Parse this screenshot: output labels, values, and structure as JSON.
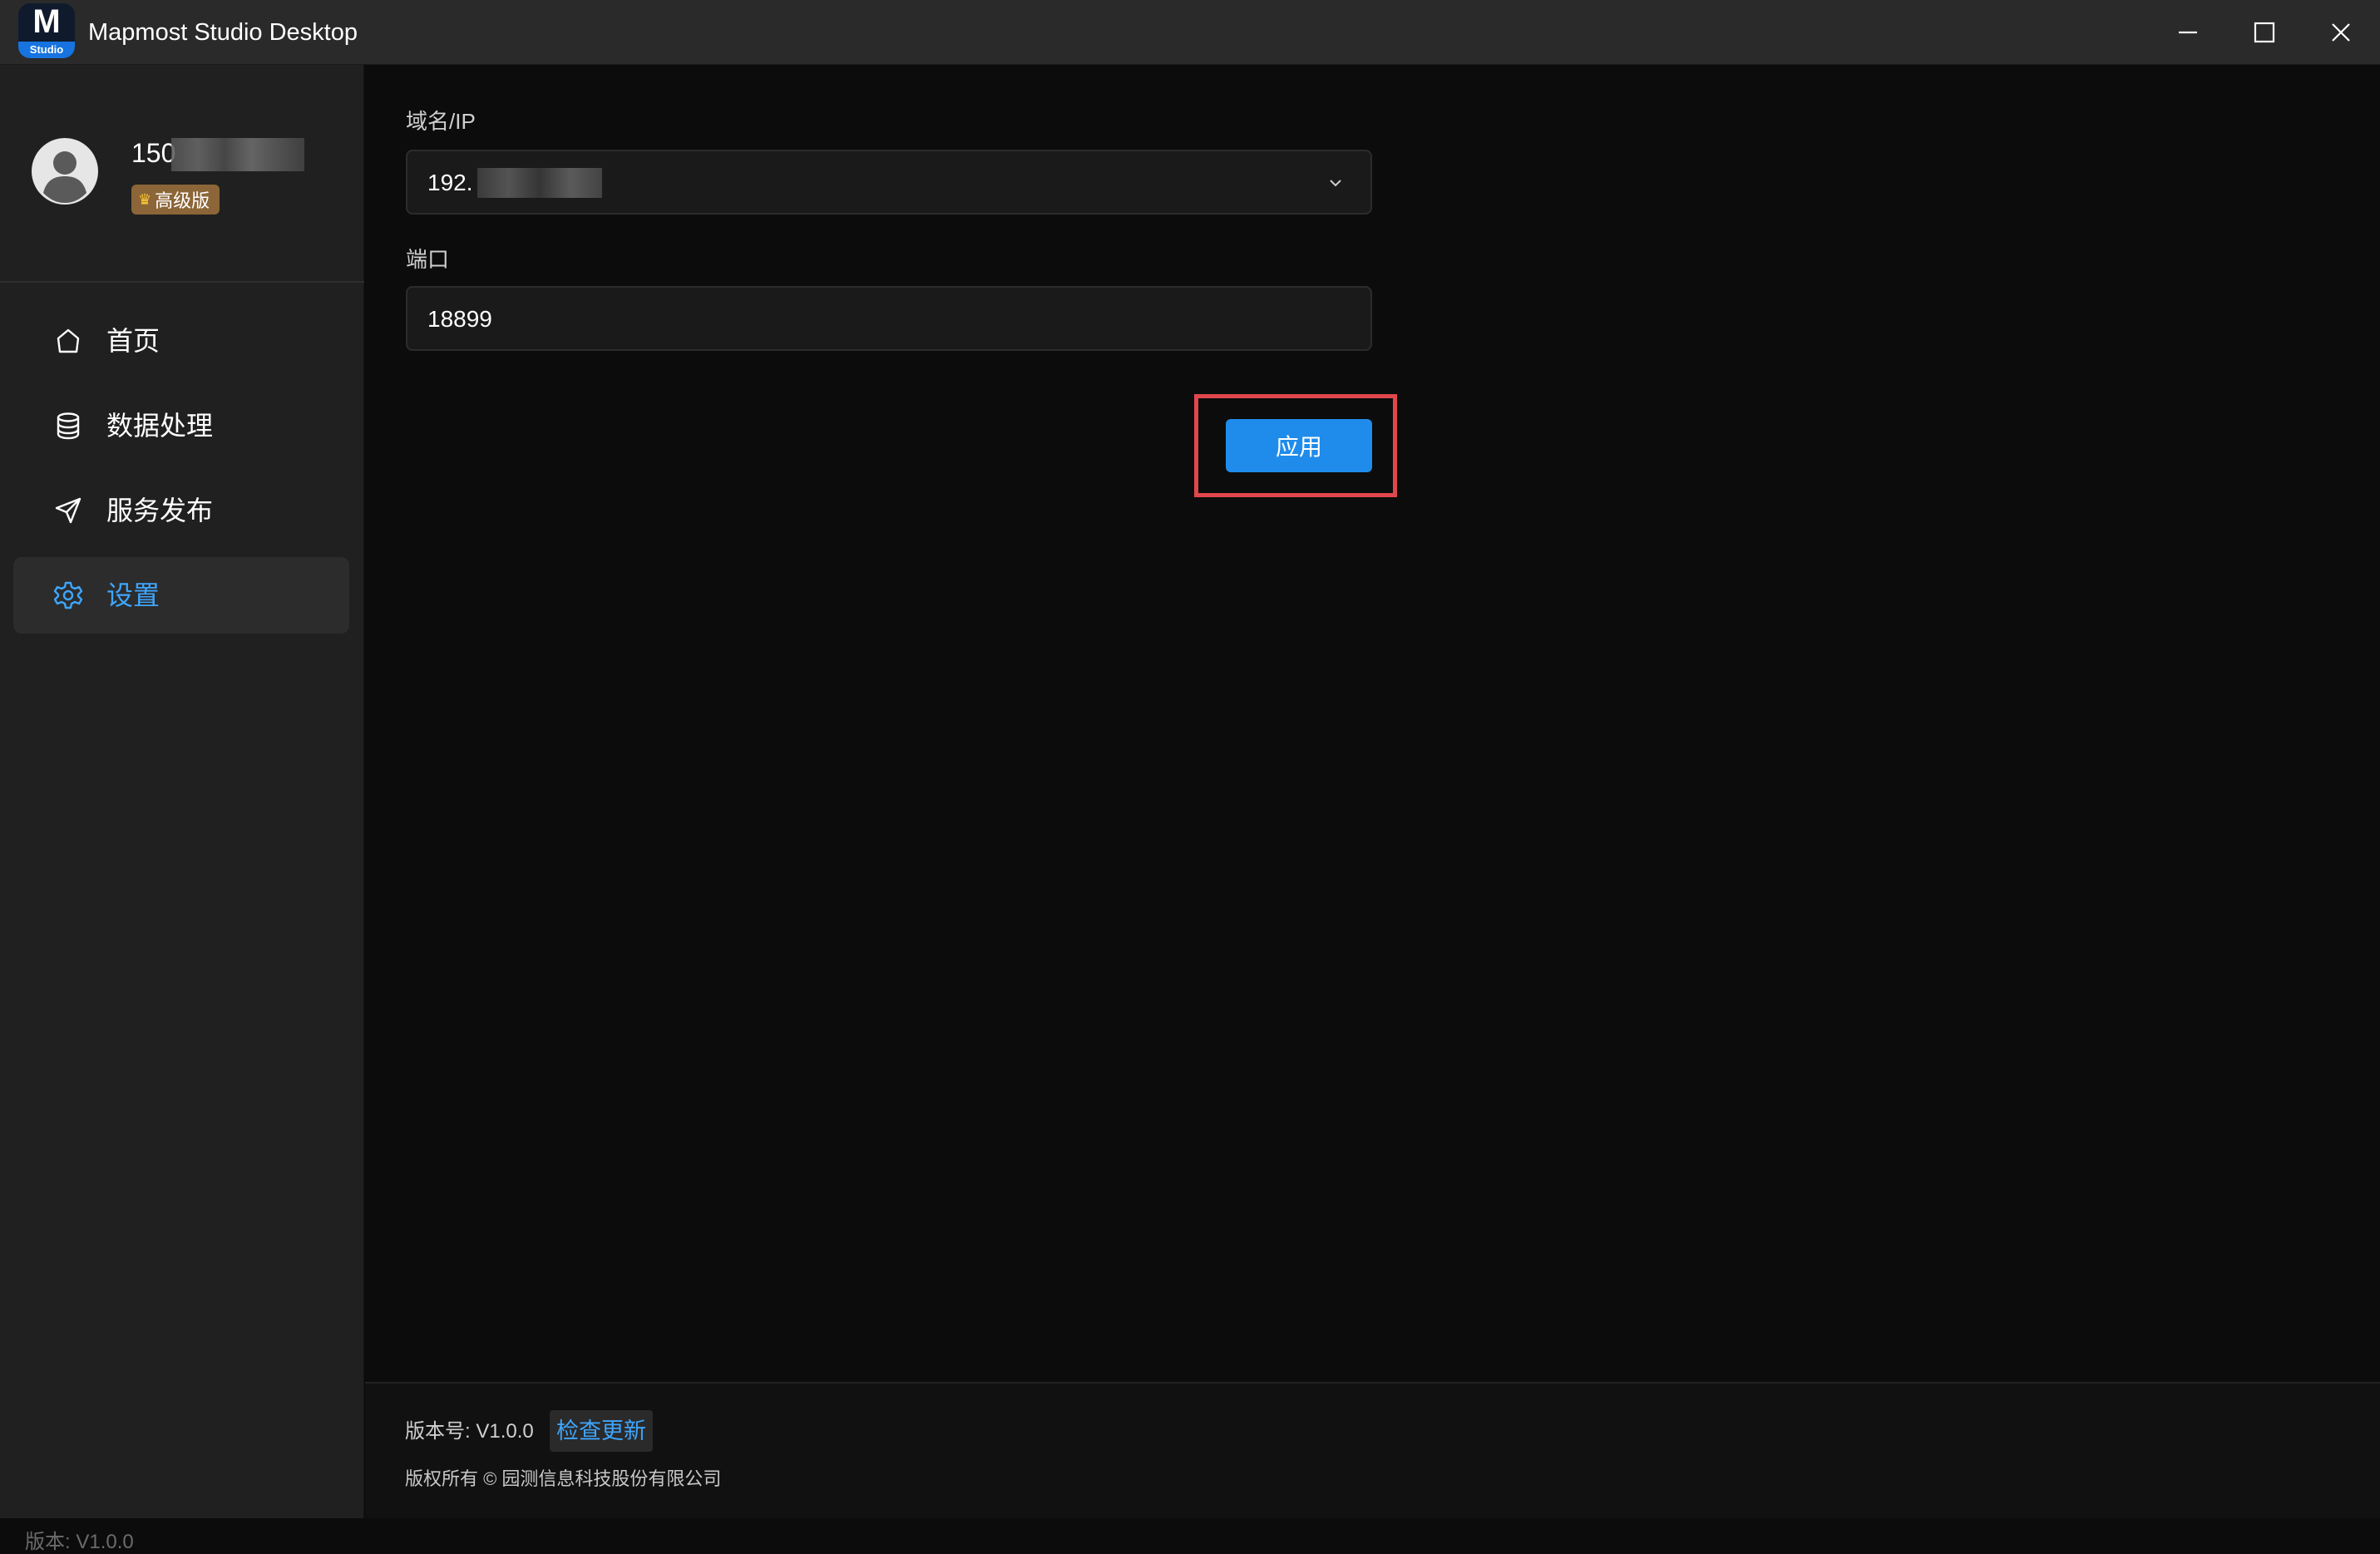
{
  "window": {
    "title": "Mapmost Studio Desktop",
    "logo_letter": "M",
    "logo_caption": "Studio",
    "minimize_icon": "minimize-icon",
    "maximize_icon": "maximize-icon",
    "close_icon": "close-icon"
  },
  "user": {
    "name_visible": "150",
    "plan_badge": "高级版",
    "avatar_icon": "user-avatar-icon"
  },
  "sidebar": {
    "items": [
      {
        "label": "首页",
        "icon": "home-icon",
        "active": false
      },
      {
        "label": "数据处理",
        "icon": "database-icon",
        "active": false
      },
      {
        "label": "服务发布",
        "icon": "send-icon",
        "active": false
      },
      {
        "label": "设置",
        "icon": "gear-icon",
        "active": true
      }
    ],
    "version": "版本: V1.0.0"
  },
  "settings": {
    "host_label": "域名/IP",
    "host_value_visible": "192.",
    "port_label": "端口",
    "port_value": "18899",
    "apply_label": "应用"
  },
  "footer": {
    "version_text": "版本号: V1.0.0",
    "check_update_label": "检查更新",
    "copyright": "版权所有 © 园测信息科技股份有限公司"
  },
  "colors": {
    "accent": "#1f8ceb",
    "active_text": "#3ea6ff",
    "highlight": "#e0474c",
    "badge": "#8c6638"
  }
}
